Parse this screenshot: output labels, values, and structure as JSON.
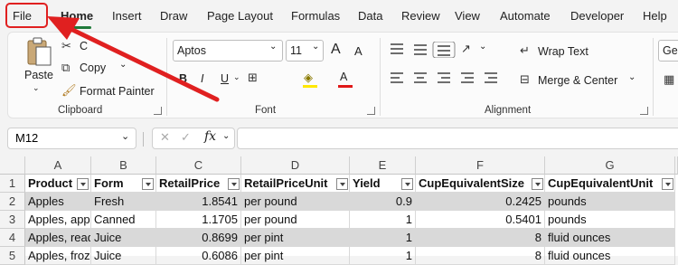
{
  "menu": [
    "File",
    "Home",
    "Insert",
    "Draw",
    "Page Layout",
    "Formulas",
    "Data",
    "Review",
    "View",
    "Automate",
    "Developer",
    "Help"
  ],
  "clipboard": {
    "paste": "Paste",
    "cut": "C",
    "copy": "Copy",
    "format_painter": "Format Painter",
    "label": "Clipboard"
  },
  "font": {
    "name": "Aptos",
    "size": "11",
    "grow": "A",
    "shrink": "A",
    "bold": "B",
    "italic": "I",
    "underline": "U",
    "font_color": "A",
    "label": "Font"
  },
  "alignment": {
    "wrap_text": "Wrap Text",
    "merge_center": "Merge & Center",
    "label": "Alignment"
  },
  "number": {
    "format": "Ger"
  },
  "formula_bar": {
    "name_box": "M12",
    "fx": "fx",
    "formula": ""
  },
  "columns": [
    "A",
    "B",
    "C",
    "D",
    "E",
    "F",
    "G"
  ],
  "rows": [
    "1",
    "2",
    "3",
    "4",
    "5"
  ],
  "headers": [
    "Product",
    "Form",
    "RetailPrice",
    "RetailPriceUnit",
    "Yield",
    "CupEquivalentSize",
    "CupEquivalentUnit"
  ],
  "table": [
    [
      "Apples",
      "Fresh",
      "1.8541",
      "per pound",
      "0.9",
      "0.2425",
      "pounds"
    ],
    [
      "Apples, applesauce",
      "Canned",
      "1.1705",
      "per pound",
      "1",
      "0.5401",
      "pounds"
    ],
    [
      "Apples, ready-to-drink",
      "Juice",
      "0.8699",
      "per pint",
      "1",
      "8",
      "fluid ounces"
    ],
    [
      "Apples, frozen concentrate",
      "Juice",
      "0.6086",
      "per pint",
      "1",
      "8",
      "fluid ounces"
    ]
  ],
  "colors": {
    "accent": "#1f7a3a",
    "annotation": "#e02020",
    "band": "#d9d9d9"
  }
}
